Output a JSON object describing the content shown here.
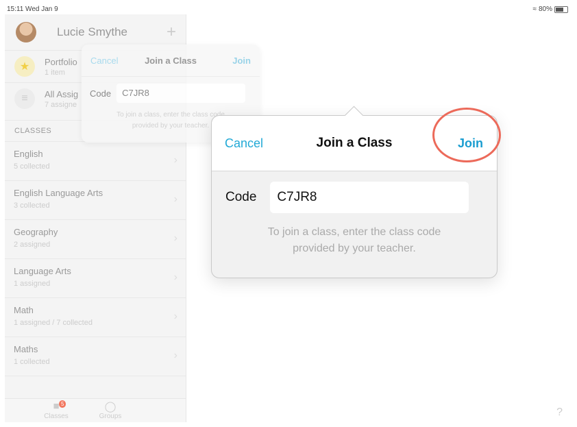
{
  "status": {
    "time": "15:11  Wed Jan 9",
    "battery": "80%",
    "battery_level": 0.8
  },
  "sidebar": {
    "username": "Lucie Smythe",
    "rows": [
      {
        "title": "Portfolio",
        "sub": "1 item"
      },
      {
        "title": "All Assig",
        "sub": "7 assigne"
      }
    ],
    "classes_header": "CLASSES",
    "classes": [
      {
        "name": "English",
        "sub": "5 collected"
      },
      {
        "name": "English Language Arts",
        "sub": "3 collected"
      },
      {
        "name": "Geography",
        "sub": "2 assigned"
      },
      {
        "name": "Language Arts",
        "sub": "1 assigned"
      },
      {
        "name": "Math",
        "sub": "1 assigned / 7 collected"
      },
      {
        "name": "Maths",
        "sub": "1 collected"
      }
    ],
    "tabs": [
      {
        "label": "Classes",
        "badge": "5"
      },
      {
        "label": "Groups"
      }
    ]
  },
  "small_popover": {
    "cancel": "Cancel",
    "title": "Join a Class",
    "join": "Join",
    "code_label": "Code",
    "code_value": "C7JR8",
    "help_line1": "To join a class, enter the class code",
    "help_line2": "provided by your teacher."
  },
  "popover": {
    "cancel": "Cancel",
    "title": "Join a Class",
    "join": "Join",
    "code_label": "Code",
    "code_value": "C7JR8",
    "help_line1": "To join a class, enter the class code",
    "help_line2": "provided by your teacher."
  },
  "help_mark": "?",
  "colors": {
    "accent": "#1a9dd0",
    "highlight": "#ec6a5a",
    "badge": "#f2765e"
  }
}
